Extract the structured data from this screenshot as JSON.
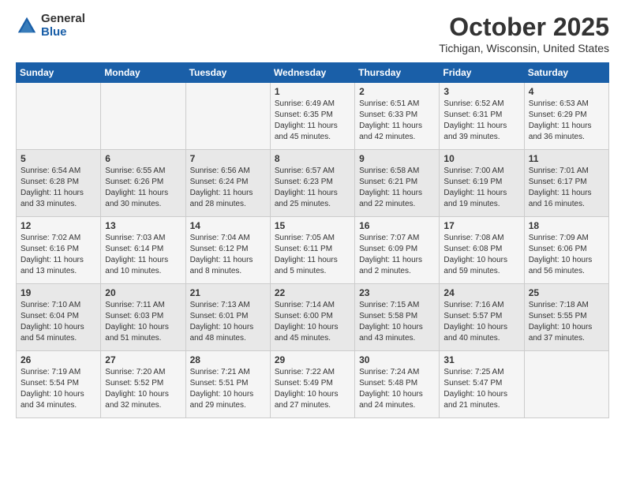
{
  "header": {
    "logo_general": "General",
    "logo_blue": "Blue",
    "month_title": "October 2025",
    "location": "Tichigan, Wisconsin, United States"
  },
  "weekdays": [
    "Sunday",
    "Monday",
    "Tuesday",
    "Wednesday",
    "Thursday",
    "Friday",
    "Saturday"
  ],
  "weeks": [
    [
      {
        "day": "",
        "content": ""
      },
      {
        "day": "",
        "content": ""
      },
      {
        "day": "",
        "content": ""
      },
      {
        "day": "1",
        "content": "Sunrise: 6:49 AM\nSunset: 6:35 PM\nDaylight: 11 hours\nand 45 minutes."
      },
      {
        "day": "2",
        "content": "Sunrise: 6:51 AM\nSunset: 6:33 PM\nDaylight: 11 hours\nand 42 minutes."
      },
      {
        "day": "3",
        "content": "Sunrise: 6:52 AM\nSunset: 6:31 PM\nDaylight: 11 hours\nand 39 minutes."
      },
      {
        "day": "4",
        "content": "Sunrise: 6:53 AM\nSunset: 6:29 PM\nDaylight: 11 hours\nand 36 minutes."
      }
    ],
    [
      {
        "day": "5",
        "content": "Sunrise: 6:54 AM\nSunset: 6:28 PM\nDaylight: 11 hours\nand 33 minutes."
      },
      {
        "day": "6",
        "content": "Sunrise: 6:55 AM\nSunset: 6:26 PM\nDaylight: 11 hours\nand 30 minutes."
      },
      {
        "day": "7",
        "content": "Sunrise: 6:56 AM\nSunset: 6:24 PM\nDaylight: 11 hours\nand 28 minutes."
      },
      {
        "day": "8",
        "content": "Sunrise: 6:57 AM\nSunset: 6:23 PM\nDaylight: 11 hours\nand 25 minutes."
      },
      {
        "day": "9",
        "content": "Sunrise: 6:58 AM\nSunset: 6:21 PM\nDaylight: 11 hours\nand 22 minutes."
      },
      {
        "day": "10",
        "content": "Sunrise: 7:00 AM\nSunset: 6:19 PM\nDaylight: 11 hours\nand 19 minutes."
      },
      {
        "day": "11",
        "content": "Sunrise: 7:01 AM\nSunset: 6:17 PM\nDaylight: 11 hours\nand 16 minutes."
      }
    ],
    [
      {
        "day": "12",
        "content": "Sunrise: 7:02 AM\nSunset: 6:16 PM\nDaylight: 11 hours\nand 13 minutes."
      },
      {
        "day": "13",
        "content": "Sunrise: 7:03 AM\nSunset: 6:14 PM\nDaylight: 11 hours\nand 10 minutes."
      },
      {
        "day": "14",
        "content": "Sunrise: 7:04 AM\nSunset: 6:12 PM\nDaylight: 11 hours\nand 8 minutes."
      },
      {
        "day": "15",
        "content": "Sunrise: 7:05 AM\nSunset: 6:11 PM\nDaylight: 11 hours\nand 5 minutes."
      },
      {
        "day": "16",
        "content": "Sunrise: 7:07 AM\nSunset: 6:09 PM\nDaylight: 11 hours\nand 2 minutes."
      },
      {
        "day": "17",
        "content": "Sunrise: 7:08 AM\nSunset: 6:08 PM\nDaylight: 10 hours\nand 59 minutes."
      },
      {
        "day": "18",
        "content": "Sunrise: 7:09 AM\nSunset: 6:06 PM\nDaylight: 10 hours\nand 56 minutes."
      }
    ],
    [
      {
        "day": "19",
        "content": "Sunrise: 7:10 AM\nSunset: 6:04 PM\nDaylight: 10 hours\nand 54 minutes."
      },
      {
        "day": "20",
        "content": "Sunrise: 7:11 AM\nSunset: 6:03 PM\nDaylight: 10 hours\nand 51 minutes."
      },
      {
        "day": "21",
        "content": "Sunrise: 7:13 AM\nSunset: 6:01 PM\nDaylight: 10 hours\nand 48 minutes."
      },
      {
        "day": "22",
        "content": "Sunrise: 7:14 AM\nSunset: 6:00 PM\nDaylight: 10 hours\nand 45 minutes."
      },
      {
        "day": "23",
        "content": "Sunrise: 7:15 AM\nSunset: 5:58 PM\nDaylight: 10 hours\nand 43 minutes."
      },
      {
        "day": "24",
        "content": "Sunrise: 7:16 AM\nSunset: 5:57 PM\nDaylight: 10 hours\nand 40 minutes."
      },
      {
        "day": "25",
        "content": "Sunrise: 7:18 AM\nSunset: 5:55 PM\nDaylight: 10 hours\nand 37 minutes."
      }
    ],
    [
      {
        "day": "26",
        "content": "Sunrise: 7:19 AM\nSunset: 5:54 PM\nDaylight: 10 hours\nand 34 minutes."
      },
      {
        "day": "27",
        "content": "Sunrise: 7:20 AM\nSunset: 5:52 PM\nDaylight: 10 hours\nand 32 minutes."
      },
      {
        "day": "28",
        "content": "Sunrise: 7:21 AM\nSunset: 5:51 PM\nDaylight: 10 hours\nand 29 minutes."
      },
      {
        "day": "29",
        "content": "Sunrise: 7:22 AM\nSunset: 5:49 PM\nDaylight: 10 hours\nand 27 minutes."
      },
      {
        "day": "30",
        "content": "Sunrise: 7:24 AM\nSunset: 5:48 PM\nDaylight: 10 hours\nand 24 minutes."
      },
      {
        "day": "31",
        "content": "Sunrise: 7:25 AM\nSunset: 5:47 PM\nDaylight: 10 hours\nand 21 minutes."
      },
      {
        "day": "",
        "content": ""
      }
    ]
  ]
}
